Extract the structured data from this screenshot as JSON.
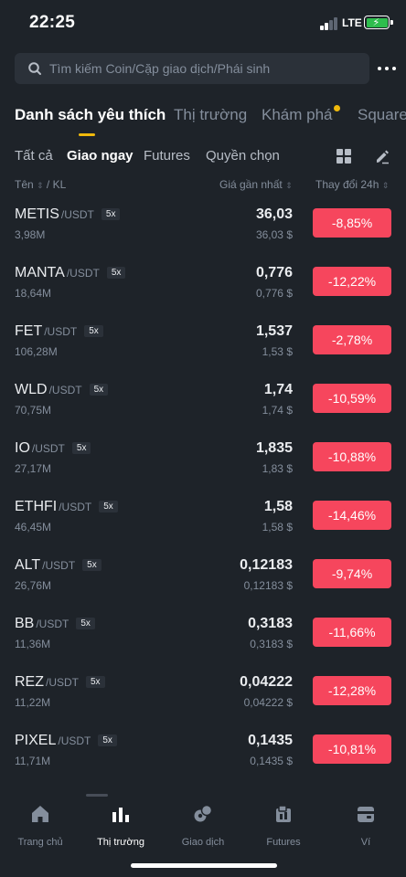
{
  "status_bar": {
    "time": "22:25",
    "network": "LTE"
  },
  "search": {
    "placeholder": "Tìm kiếm Coin/Cặp giao dịch/Phái sinh"
  },
  "main_tabs": [
    {
      "label": "Danh sách yêu thích",
      "active": true
    },
    {
      "label": "Thị trường",
      "active": false
    },
    {
      "label": "Khám phá",
      "active": false,
      "badge_dot": true
    },
    {
      "label": "Square",
      "active": false
    }
  ],
  "sub_tabs": [
    {
      "label": "Tất cả",
      "active": false
    },
    {
      "label": "Giao ngay",
      "active": true
    },
    {
      "label": "Futures",
      "active": false
    },
    {
      "label": "Quyền chọn",
      "active": false
    }
  ],
  "columns": {
    "name": "Tên",
    "volume": "KL",
    "last_price": "Giá gần nhất",
    "change_24h": "Thay đổi 24h"
  },
  "rows": [
    {
      "base": "METIS",
      "quote": "/USDT",
      "leverage": "5x",
      "volume": "3,98M",
      "price": "36,03",
      "fiat": "36,03 $",
      "change": "-8,85%"
    },
    {
      "base": "MANTA",
      "quote": "/USDT",
      "leverage": "5x",
      "volume": "18,64M",
      "price": "0,776",
      "fiat": "0,776 $",
      "change": "-12,22%"
    },
    {
      "base": "FET",
      "quote": "/USDT",
      "leverage": "5x",
      "volume": "106,28M",
      "price": "1,537",
      "fiat": "1,53 $",
      "change": "-2,78%"
    },
    {
      "base": "WLD",
      "quote": "/USDT",
      "leverage": "5x",
      "volume": "70,75M",
      "price": "1,74",
      "fiat": "1,74 $",
      "change": "-10,59%"
    },
    {
      "base": "IO",
      "quote": "/USDT",
      "leverage": "5x",
      "volume": "27,17M",
      "price": "1,835",
      "fiat": "1,83 $",
      "change": "-10,88%"
    },
    {
      "base": "ETHFI",
      "quote": "/USDT",
      "leverage": "5x",
      "volume": "46,45M",
      "price": "1,58",
      "fiat": "1,58 $",
      "change": "-14,46%"
    },
    {
      "base": "ALT",
      "quote": "/USDT",
      "leverage": "5x",
      "volume": "26,76M",
      "price": "0,12183",
      "fiat": "0,12183 $",
      "change": "-9,74%"
    },
    {
      "base": "BB",
      "quote": "/USDT",
      "leverage": "5x",
      "volume": "11,36M",
      "price": "0,3183",
      "fiat": "0,3183 $",
      "change": "-11,66%"
    },
    {
      "base": "REZ",
      "quote": "/USDT",
      "leverage": "5x",
      "volume": "11,22M",
      "price": "0,04222",
      "fiat": "0,04222 $",
      "change": "-12,28%"
    },
    {
      "base": "PIXEL",
      "quote": "/USDT",
      "leverage": "5x",
      "volume": "11,71M",
      "price": "0,1435",
      "fiat": "0,1435 $",
      "change": "-10,81%"
    }
  ],
  "bottom_nav": [
    {
      "label": "Trang chủ",
      "icon": "home-icon",
      "active": false
    },
    {
      "label": "Thị trường",
      "icon": "bar-chart-icon",
      "active": true
    },
    {
      "label": "Giao dịch",
      "icon": "trade-icon",
      "active": false
    },
    {
      "label": "Futures",
      "icon": "futures-icon",
      "active": false
    },
    {
      "label": "Ví",
      "icon": "wallet-icon",
      "active": false
    }
  ],
  "colors": {
    "background": "#1e2329",
    "accent": "#f0b90b",
    "negative": "#f6465d",
    "muted_text": "#848e9c"
  }
}
